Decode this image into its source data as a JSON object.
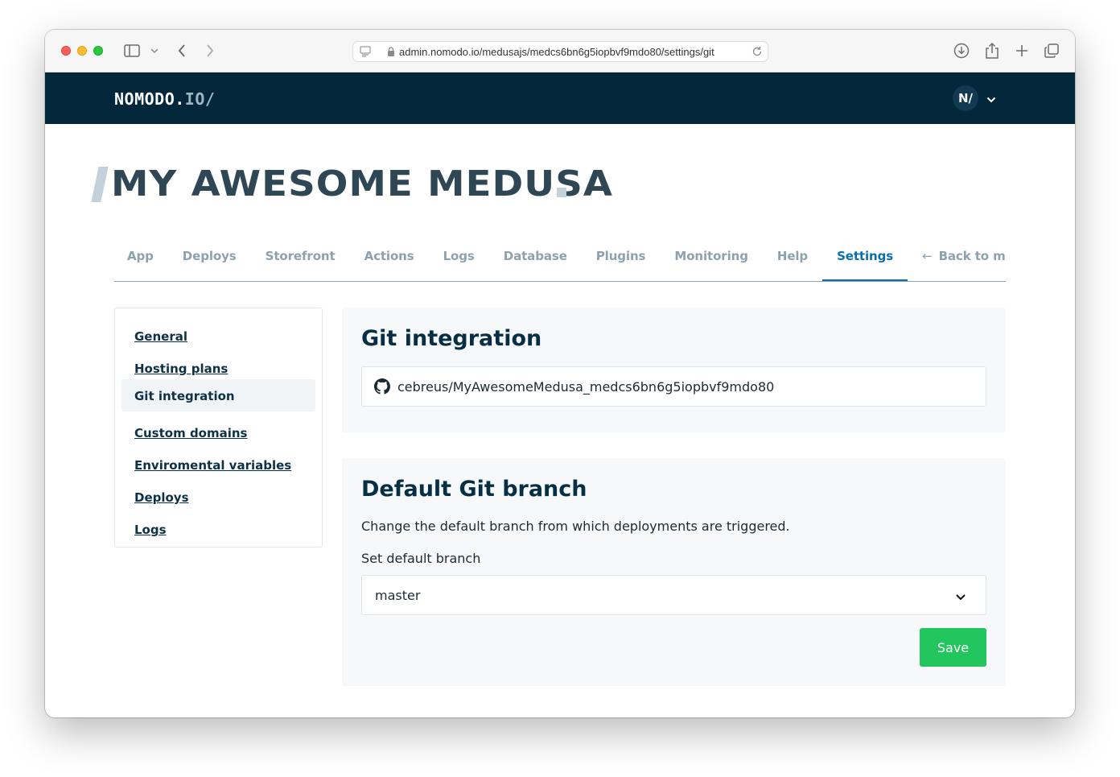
{
  "browser": {
    "url": "admin.nomodo.io/medusajs/medcs6bn6g5iopbvf9mdo80/settings/git"
  },
  "header": {
    "logo_main": "NOMODO.",
    "logo_io": "IO/",
    "avatar_initials": "N/"
  },
  "project": {
    "title": "MY AWESOME MEDUSA"
  },
  "tabs": [
    {
      "label": "App"
    },
    {
      "label": "Deploys"
    },
    {
      "label": "Storefront"
    },
    {
      "label": "Actions"
    },
    {
      "label": "Logs"
    },
    {
      "label": "Database"
    },
    {
      "label": "Plugins"
    },
    {
      "label": "Monitoring"
    },
    {
      "label": "Help"
    },
    {
      "label": "Settings"
    },
    {
      "label": "Back to my ap"
    }
  ],
  "sidebar": {
    "items": [
      {
        "label": "General"
      },
      {
        "label": "Hosting plans"
      },
      {
        "label": "Git integration"
      },
      {
        "label": "Custom domains"
      },
      {
        "label": "Enviromental variables"
      },
      {
        "label": "Deploys"
      },
      {
        "label": "Logs"
      }
    ]
  },
  "git_integration": {
    "title": "Git integration",
    "repo": "cebreus/MyAwesomeMedusa_medcs6bn6g5iopbvf9mdo80"
  },
  "default_branch": {
    "title": "Default Git branch",
    "description": "Change the default branch from which deployments are triggered.",
    "field_label": "Set default branch",
    "selected": "master",
    "save_label": "Save"
  },
  "colors": {
    "header_bg": "#02263a",
    "active_tab": "#0a6fb0",
    "save_button": "#22c55e"
  }
}
